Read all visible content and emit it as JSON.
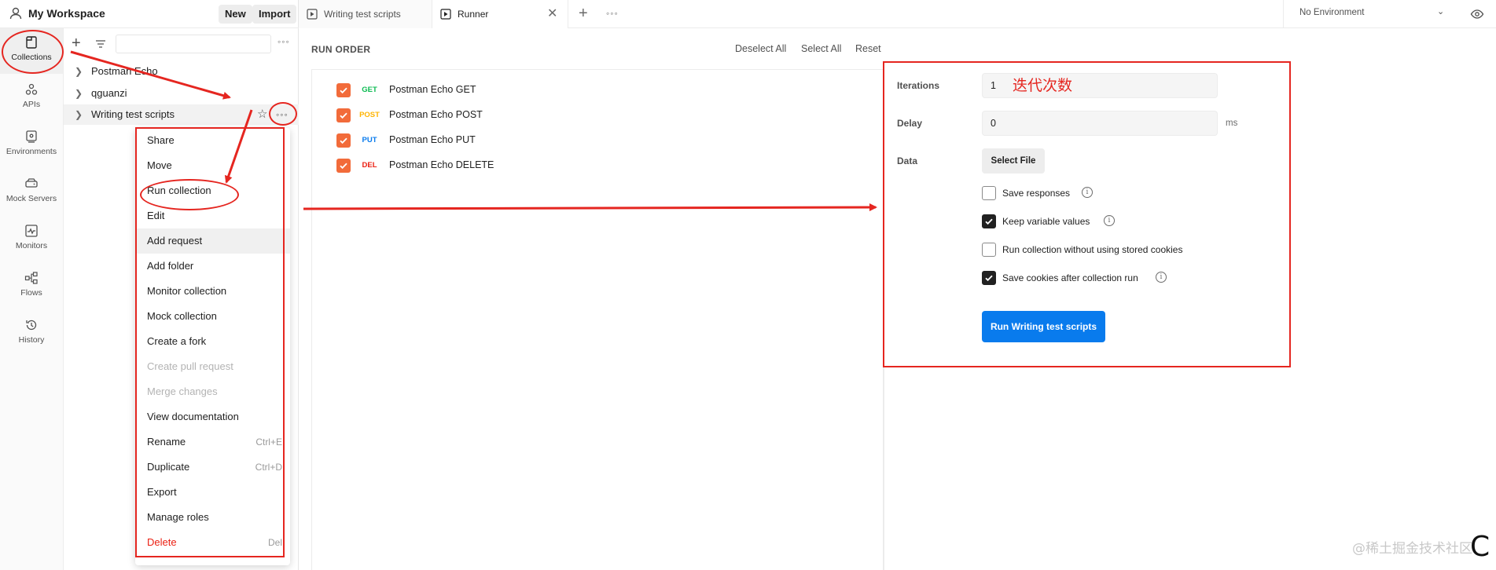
{
  "workspace": {
    "name": "My Workspace",
    "new_label": "New",
    "import_label": "Import"
  },
  "sidebar": {
    "items": [
      {
        "label": "Collections",
        "icon": "collections-icon",
        "active": true
      },
      {
        "label": "APIs",
        "icon": "apis-icon"
      },
      {
        "label": "Environments",
        "icon": "environments-icon"
      },
      {
        "label": "Mock Servers",
        "icon": "mock-servers-icon"
      },
      {
        "label": "Monitors",
        "icon": "monitors-icon"
      },
      {
        "label": "Flows",
        "icon": "flows-icon"
      },
      {
        "label": "History",
        "icon": "history-icon"
      }
    ]
  },
  "tree": {
    "collections": [
      "Postman Echo",
      "qguanzi",
      "Writing test scripts"
    ]
  },
  "context_menu": {
    "items": [
      {
        "label": "Share",
        "shortcut": ""
      },
      {
        "label": "Move",
        "shortcut": ""
      },
      {
        "label": "Run collection",
        "shortcut": ""
      },
      {
        "label": "Edit",
        "shortcut": ""
      },
      {
        "label": "Add request",
        "shortcut": ""
      },
      {
        "label": "Add folder",
        "shortcut": ""
      },
      {
        "label": "Monitor collection",
        "shortcut": ""
      },
      {
        "label": "Mock collection",
        "shortcut": ""
      },
      {
        "label": "Create a fork",
        "shortcut": ""
      },
      {
        "label": "Create pull request",
        "shortcut": ""
      },
      {
        "label": "Merge changes",
        "shortcut": ""
      },
      {
        "label": "View documentation",
        "shortcut": ""
      },
      {
        "label": "Rename",
        "shortcut": "Ctrl+E"
      },
      {
        "label": "Duplicate",
        "shortcut": "Ctrl+D"
      },
      {
        "label": "Export",
        "shortcut": ""
      },
      {
        "label": "Manage roles",
        "shortcut": ""
      },
      {
        "label": "Delete",
        "shortcut": "Del"
      }
    ]
  },
  "tabs": [
    {
      "label": "Writing test scripts"
    },
    {
      "label": "Runner"
    }
  ],
  "environment": {
    "label": "No Environment"
  },
  "runner": {
    "run_order_title": "RUN ORDER",
    "deselect_all": "Deselect All",
    "select_all": "Select All",
    "reset": "Reset",
    "requests": [
      {
        "method": "GET",
        "name": "Postman Echo GET",
        "color": "#0cbb52"
      },
      {
        "method": "POST",
        "name": "Postman Echo POST",
        "color": "#ffb400"
      },
      {
        "method": "PUT",
        "name": "Postman Echo PUT",
        "color": "#097bed"
      },
      {
        "method": "DEL",
        "name": "Postman Echo DELETE",
        "color": "#eb2013"
      }
    ],
    "iterations_label": "Iterations",
    "iterations_value": "1",
    "delay_label": "Delay",
    "delay_value": "0",
    "delay_unit": "ms",
    "data_label": "Data",
    "select_file": "Select File",
    "options": [
      {
        "label": "Save responses",
        "checked": false,
        "info": true
      },
      {
        "label": "Keep variable values",
        "checked": true,
        "info": true
      },
      {
        "label": "Run collection without using stored cookies",
        "checked": false,
        "info": false
      },
      {
        "label": "Save cookies after collection run",
        "checked": true,
        "info": true
      }
    ],
    "run_button": "Run Writing test scripts"
  },
  "annotations": {
    "iterations_note": "迭代次数",
    "watermark": "@稀土掘金技术社区",
    "corner_mark": "C"
  },
  "colors": {
    "accent_orange": "#f26b3a",
    "primary_blue": "#097bed",
    "annotation_red": "#e52620"
  }
}
